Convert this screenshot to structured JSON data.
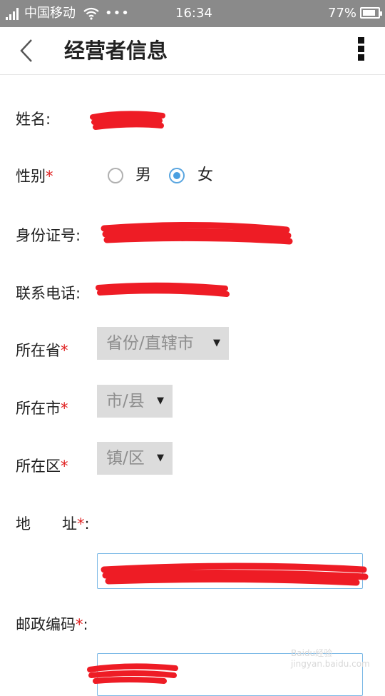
{
  "status_bar": {
    "carrier": "中国移动",
    "dots": "•••",
    "time": "16:34",
    "battery_text": "77%",
    "battery_level": 0.77
  },
  "nav": {
    "title": "经营者信息",
    "back_icon": "chevron-left-icon",
    "menu_icon": "more-vertical-icon"
  },
  "form": {
    "name_label": "姓名:",
    "gender_label": "性别",
    "required_mark": "*",
    "gender_options": [
      "男",
      "女"
    ],
    "gender_selected": "女",
    "id_label": "身份证号:",
    "phone_label": "联系电话:",
    "province_label": "所在省",
    "province_placeholder": "省份/直辖市",
    "city_label": "所在市",
    "city_placeholder": "市/县",
    "district_label": "所在区",
    "district_placeholder": "镇/区",
    "address_label_part1": "地",
    "address_label_part2": "址",
    "colon": ":",
    "postcode_label": "邮政编码",
    "dropdown_arrow": "▼"
  },
  "colors": {
    "status_bar_bg": "#8a8a8a",
    "required": "#e02020",
    "radio_selected": "#4a9fe0",
    "redaction": "#ee1c25",
    "select_bg": "#dcdcdc",
    "input_border": "#7ab8e6"
  },
  "watermark": "Baidu经验 jingyan.baidu.com"
}
